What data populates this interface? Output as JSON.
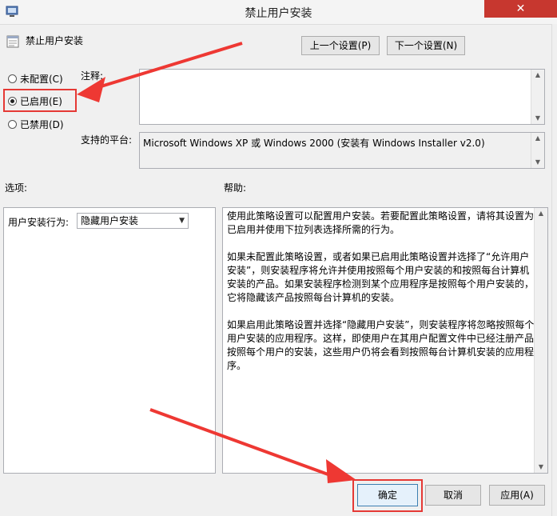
{
  "window": {
    "title": "禁止用户安装",
    "close_glyph": "✕"
  },
  "header": {
    "policy_name": "禁止用户安装",
    "prev_setting_label": "上一个设置(P)",
    "next_setting_label": "下一个设置(N)"
  },
  "state_options": [
    {
      "label": "未配置(C)",
      "selected": false
    },
    {
      "label": "已启用(E)",
      "selected": true
    },
    {
      "label": "已禁用(D)",
      "selected": false
    }
  ],
  "comment": {
    "label": "注释:",
    "value": ""
  },
  "platform": {
    "label": "支持的平台:",
    "value": "Microsoft Windows XP 或 Windows 2000 (安装有 Windows Installer v2.0)"
  },
  "options": {
    "label": "选项:",
    "install_behavior_label": "用户安装行为:",
    "install_behavior_value": "隐藏用户安装"
  },
  "help": {
    "label": "帮助:",
    "paragraphs": [
      "使用此策略设置可以配置用户安装。若要配置此策略设置，请将其设置为已启用并使用下拉列表选择所需的行为。",
      "如果未配置此策略设置，或者如果已启用此策略设置并选择了“允许用户安装”，则安装程序将允许并使用按照每个用户安装的和按照每台计算机安装的产品。如果安装程序检测到某个应用程序是按照每个用户安装的，它将隐藏该产品按照每台计算机的安装。",
      "如果启用此策略设置并选择“隐藏用户安装”，则安装程序将忽略按照每个用户安装的应用程序。这样，即使用户在其用户配置文件中已经注册产品按照每个用户的安装，这些用户仍将会看到按照每台计算机安装的应用程序。"
    ]
  },
  "footer": {
    "ok_label": "确定",
    "cancel_label": "取消",
    "apply_label": "应用(A)"
  },
  "colors": {
    "annotation": "#ee3833",
    "close": "#c7372f"
  }
}
